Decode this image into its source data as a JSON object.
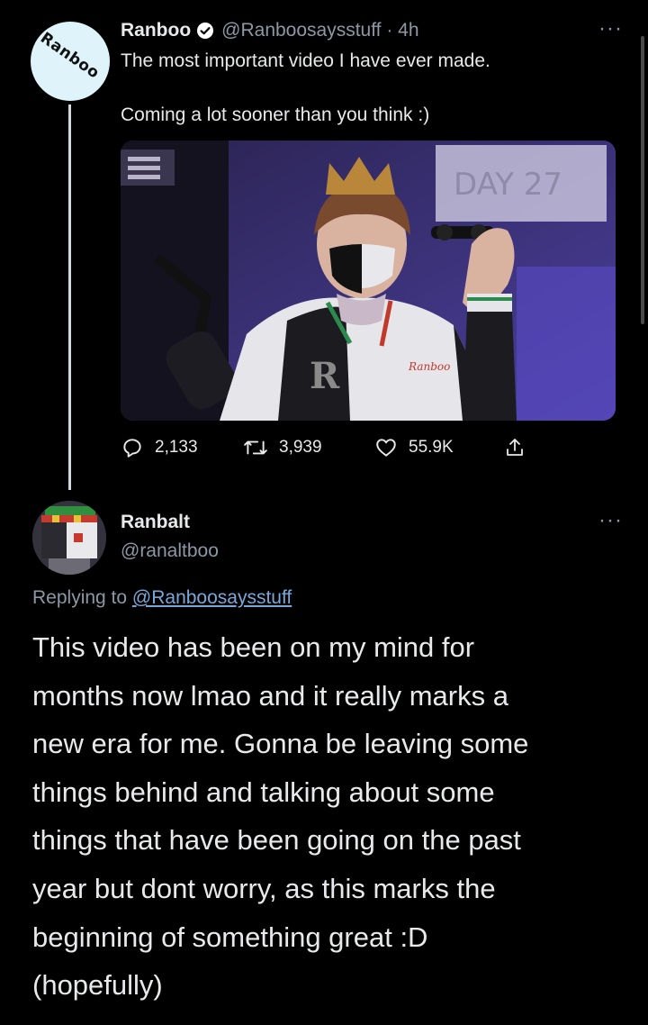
{
  "tweet": {
    "avatar_text": "Ranboo",
    "name": "Ranboo",
    "handle_time": "@Ranboosaysstuff · 4h",
    "text_line1": "The most important video I have ever made.",
    "text_line2": "Coming a lot sooner than you think :)",
    "media": {
      "board_text": "DAY 27",
      "jacket_letter": "R",
      "jacket_script": "Ranboo"
    },
    "replies": "2,133",
    "retweets": "3,939",
    "likes": "55.9K",
    "more": "···"
  },
  "reply": {
    "name": "Ranbalt",
    "handle": "@ranaltboo",
    "replying_prefix": "Replying to",
    "replying_mention": "@Ranboosaysstuff",
    "more": "···",
    "lines": [
      "This video has been on my mind for",
      "months now lmao and it really marks a",
      "new era for me. Gonna be leaving some",
      "things behind and talking about some",
      "things that have been going on the past",
      "year but dont worry, as this marks the",
      "beginning of something great :D",
      "(hopefully)"
    ]
  },
  "colors": {
    "background": "#000000",
    "text": "#e7e9ea",
    "secondary": "#8b98a5",
    "verified": "#ffffff",
    "mention": "#7aa7d9",
    "thread_line": "#cfd9de"
  }
}
